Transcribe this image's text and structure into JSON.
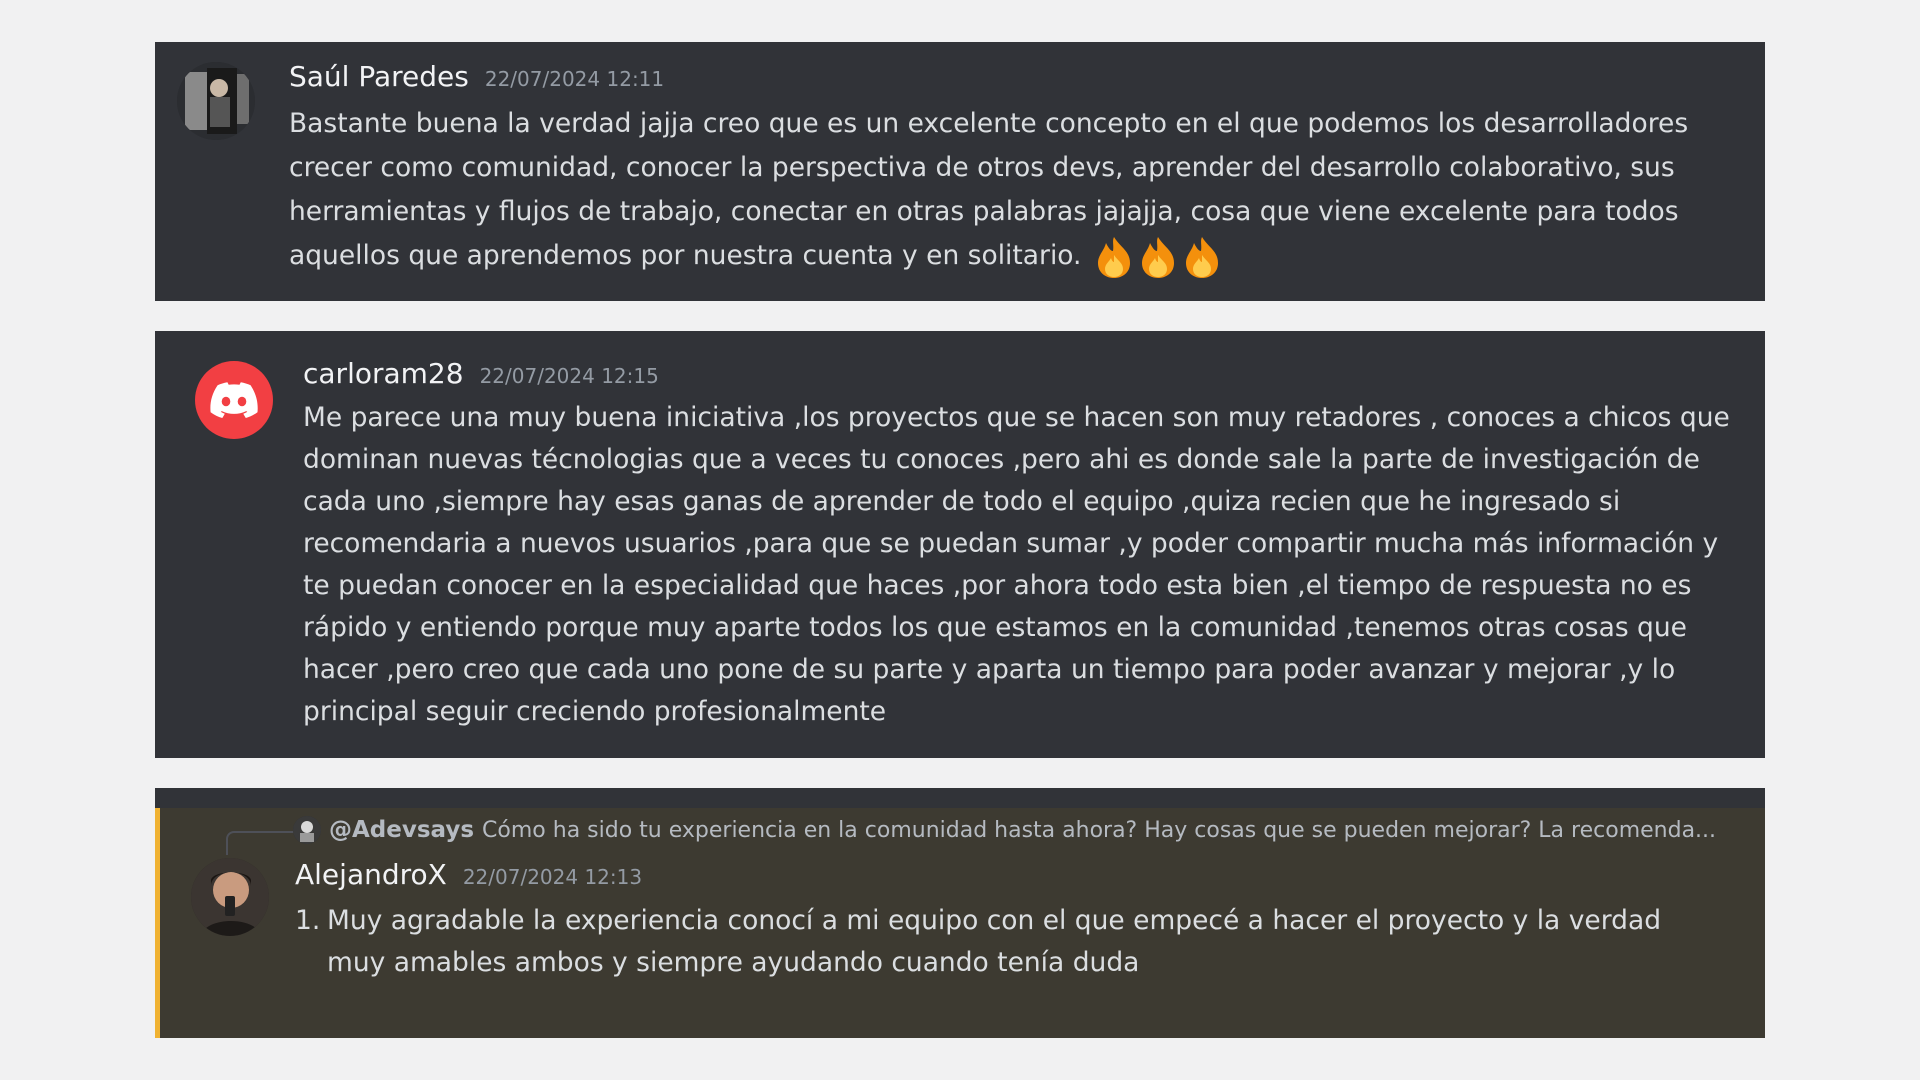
{
  "messages": [
    {
      "author": "Saúl Paredes",
      "timestamp": "22/07/2024 12:11",
      "text": "Bastante buena la verdad jajja creo que es un excelente concepto en el que podemos los desarrolladores crecer como comunidad, conocer la perspectiva de otros devs, aprender del desarrollo colaborativo, sus herramientas y flujos de trabajo, conectar en otras palabras jajajja, cosa que viene excelente para todos aquellos que aprendemos por nuestra cuenta y en solitario.",
      "emojis": [
        "fire",
        "fire",
        "fire"
      ]
    },
    {
      "author": "carloram28",
      "timestamp": "22/07/2024 12:15",
      "text": "Me parece una muy buena iniciativa ,los proyectos que se hacen son muy retadores , conoces a chicos que dominan nuevas técnologias  que a veces tu conoces ,pero ahi es donde sale la parte de investigación de cada uno ,siempre hay esas ganas de aprender de todo el equipo ,quiza recien que he ingresado si recomendaria a nuevos usuarios ,para que se puedan sumar ,y poder compartir mucha más información y te puedan conocer en la especialidad que haces ,por ahora todo esta bien ,el tiempo de respuesta no es rápido y entiendo porque muy aparte todos los que estamos en la comunidad ,tenemos otras cosas que hacer ,pero creo que cada uno pone de su parte y aparta un tiempo para poder avanzar y mejorar ,y lo principal seguir creciendo profesionalmente"
    },
    {
      "reply": {
        "author": "@Adevsays",
        "text": "Cómo ha sido tu experiencia en la comunidad hasta ahora? Hay cosas que se pueden mejorar? La recomenda..."
      },
      "author": "AlejandroX",
      "timestamp": "22/07/2024 12:13",
      "list_number": "1.",
      "text": "Muy agradable la experiencia conocí a mi equipo con el que empecé a hacer el proyecto y la verdad muy amables ambos y siempre ayudando cuando tenía duda"
    }
  ],
  "colors": {
    "page_background": "#f1f1f2",
    "card_background": "#313338",
    "mention_highlight": "#3d3a31",
    "mention_bar": "#f0b232",
    "discord_red": "#f23f43"
  }
}
